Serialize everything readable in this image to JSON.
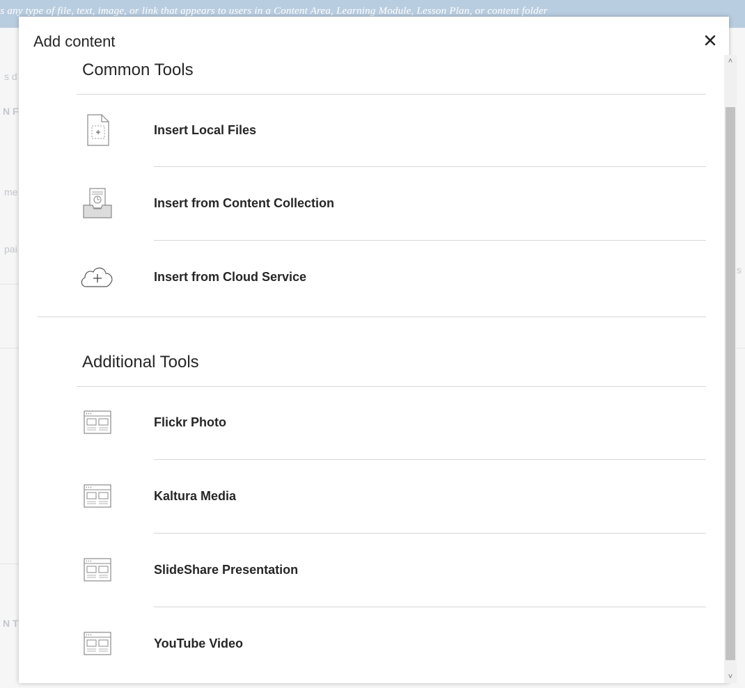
{
  "background": {
    "banner_text": "is any type of file, text, image, or link that appears to users in a Content Area, Learning Module, Lesson Plan, or content folder",
    "fragments": [
      "s d",
      "N F",
      "me",
      "pai",
      "N T",
      "s"
    ]
  },
  "modal": {
    "title": "Add content",
    "close_symbol": "✕",
    "sections": [
      {
        "title": "Common Tools",
        "items": [
          {
            "label": "Insert Local Files",
            "icon": "file-add-icon"
          },
          {
            "label": "Insert from Content Collection",
            "icon": "content-collection-icon"
          },
          {
            "label": "Insert from Cloud Service",
            "icon": "cloud-add-icon"
          }
        ]
      },
      {
        "title": "Additional Tools",
        "items": [
          {
            "label": "Flickr Photo",
            "icon": "web-tool-icon"
          },
          {
            "label": "Kaltura Media",
            "icon": "web-tool-icon"
          },
          {
            "label": "SlideShare Presentation",
            "icon": "web-tool-icon"
          },
          {
            "label": "YouTube Video",
            "icon": "web-tool-icon"
          }
        ]
      }
    ]
  },
  "scrollbar": {
    "up_symbol": "˄",
    "down_symbol": "˅"
  }
}
